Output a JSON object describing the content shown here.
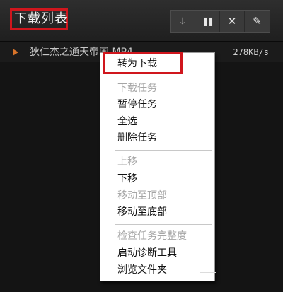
{
  "header": {
    "title": "下载列表",
    "toolbar": [
      {
        "icon": "download-icon",
        "glyph": "⤓"
      },
      {
        "icon": "pause-icon",
        "glyph": "❚❚"
      },
      {
        "icon": "close-icon",
        "glyph": "✕"
      },
      {
        "icon": "broom-icon",
        "glyph": "✎"
      }
    ]
  },
  "task": {
    "name": "狄仁杰之通天帝国.MP4",
    "speed": "278KB/s"
  },
  "context_menu": {
    "items": [
      {
        "label": "转为下载",
        "enabled": true
      },
      {
        "label": "下载任务",
        "enabled": false
      },
      {
        "label": "暂停任务",
        "enabled": true
      },
      {
        "label": "全选",
        "enabled": true
      },
      {
        "label": "删除任务",
        "enabled": true
      },
      {
        "label": "上移",
        "enabled": false
      },
      {
        "label": "下移",
        "enabled": true
      },
      {
        "label": "移动至顶部",
        "enabled": false
      },
      {
        "label": "移动至底部",
        "enabled": true
      },
      {
        "label": "检查任务完整度",
        "enabled": false
      },
      {
        "label": "启动诊断工具",
        "enabled": true
      },
      {
        "label": "浏览文件夹",
        "enabled": true
      }
    ]
  },
  "colors": {
    "highlight_border": "#d0161d",
    "accent_play": "#d8742a"
  }
}
